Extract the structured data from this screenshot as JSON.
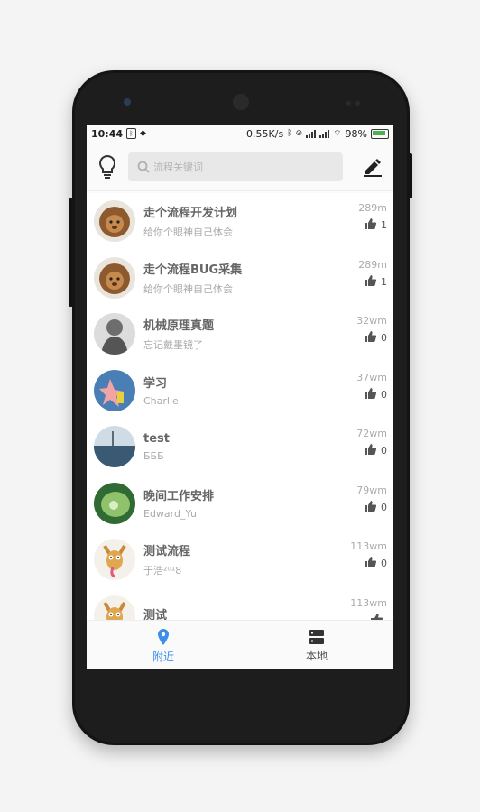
{
  "status_bar": {
    "time": "10:44",
    "speed": "0.55K/s",
    "battery": "98%"
  },
  "search": {
    "placeholder": "流程关键词"
  },
  "items": [
    {
      "title": "走个流程开发计划",
      "subtitle": "给你个眼神自己体会",
      "distance": "289m",
      "likes": "1",
      "avatar": "lion-avatar"
    },
    {
      "title": "走个流程BUG采集",
      "subtitle": "给你个眼神自己体会",
      "distance": "289m",
      "likes": "1",
      "avatar": "lion-avatar"
    },
    {
      "title": "机械原理真题",
      "subtitle": "忘记戴墨镜了",
      "distance": "32wm",
      "likes": "0",
      "avatar": "statue-avatar"
    },
    {
      "title": "学习",
      "subtitle": "Charlie",
      "distance": "37wm",
      "likes": "0",
      "avatar": "starfish-avatar"
    },
    {
      "title": "test",
      "subtitle": "БББ",
      "distance": "72wm",
      "likes": "0",
      "avatar": "ocean-avatar"
    },
    {
      "title": "晚间工作安排",
      "subtitle": "Edward_Yu",
      "distance": "79wm",
      "likes": "0",
      "avatar": "leaf-avatar"
    },
    {
      "title": "测试流程",
      "subtitle": "于浩²⁰¹8",
      "distance": "113wm",
      "likes": "0",
      "avatar": "dog-avatar"
    },
    {
      "title": "测试",
      "subtitle": "",
      "distance": "113wm",
      "likes": "",
      "avatar": "dog-avatar"
    }
  ],
  "tabs": [
    {
      "label": "附近",
      "icon": "location-pin-icon",
      "active": true
    },
    {
      "label": "本地",
      "icon": "storage-icon",
      "active": false
    }
  ],
  "colors": {
    "accent": "#3d8ee9",
    "battery": "#4caf50"
  }
}
